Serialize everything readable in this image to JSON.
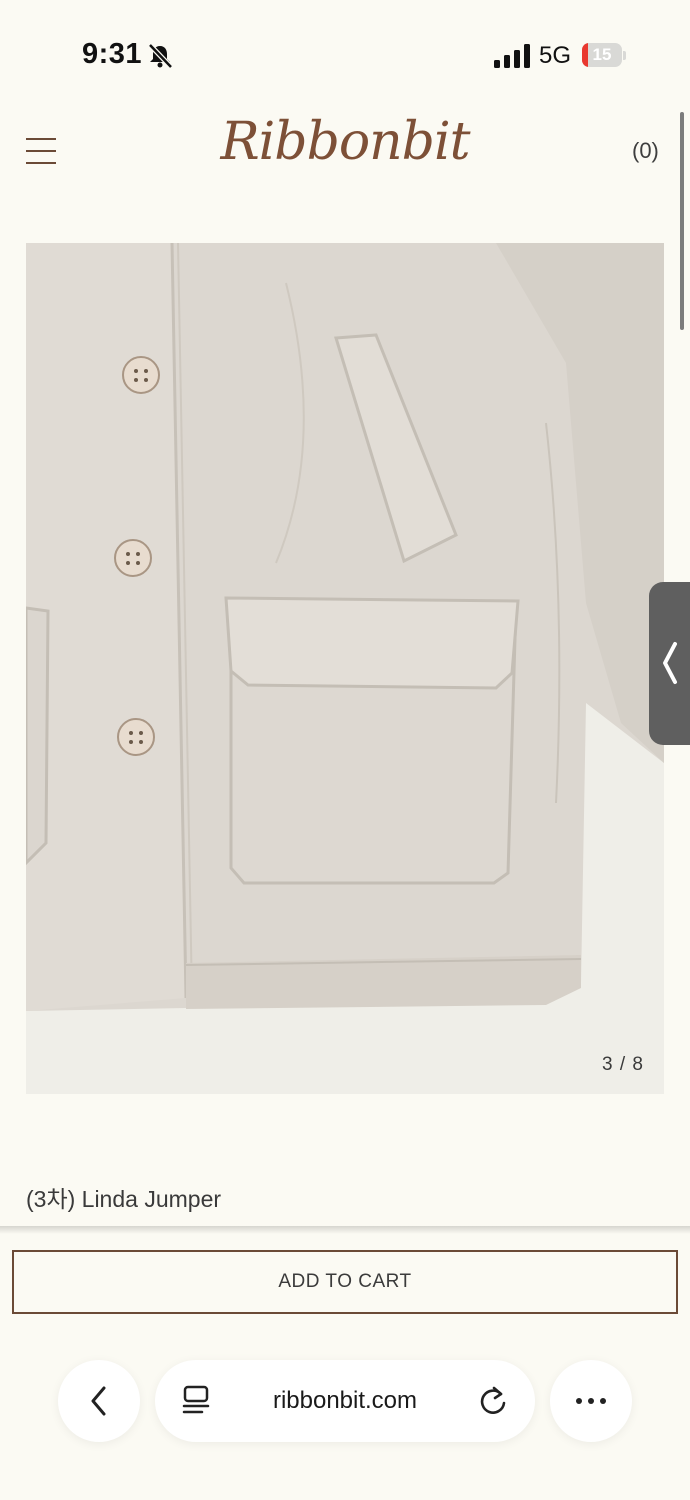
{
  "status_bar": {
    "time": "9:31",
    "network": "5G",
    "battery_level": "15",
    "battery_fraction": 0.15,
    "icons": [
      "bell-slash-icon",
      "signal-icon",
      "battery-icon"
    ],
    "battery_color": "#e9382f"
  },
  "header": {
    "logo": "Ribbonbit",
    "cart_count": "(0)",
    "menu_icon": "hamburger-menu-icon",
    "logo_color": "#7d5037"
  },
  "product": {
    "image_counter": "3 / 8",
    "name": "(3차) Linda Jumper",
    "image_description": "beige jacket detail",
    "side_tab_icon": "chevron-left-icon"
  },
  "actions": {
    "add_to_cart": "ADD TO CART"
  },
  "browser": {
    "url": "ribbonbit.com",
    "back_icon": "chevron-left-icon",
    "reader_icon": "page-layout-icon",
    "reload_icon": "reload-icon",
    "more_icon": "more-dots-icon"
  },
  "colors": {
    "background": "#fbfaf3",
    "accent": "#6b4a36",
    "jacket": "#dcd7d0"
  }
}
